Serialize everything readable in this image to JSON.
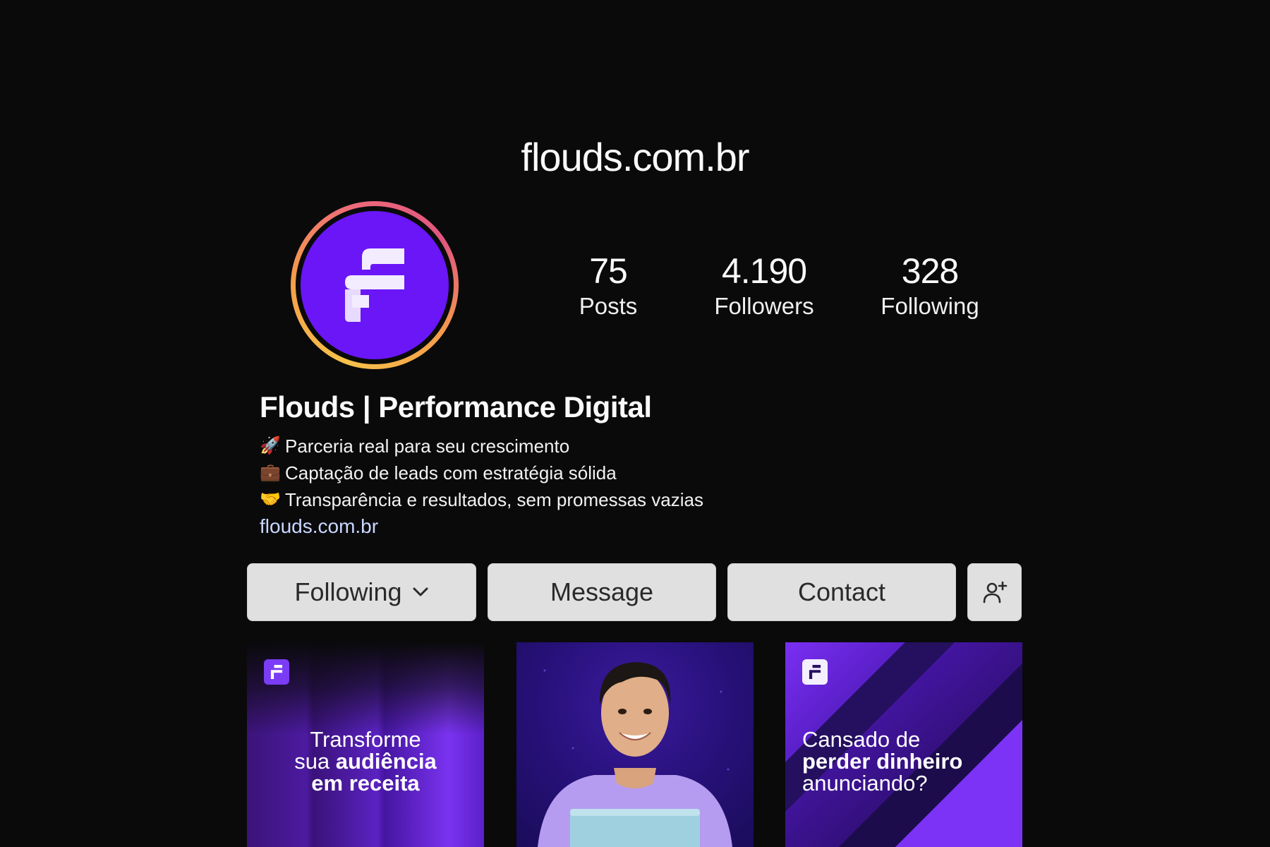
{
  "header": {
    "handle": "flouds.com.br"
  },
  "profile": {
    "avatar_icon": "flouds-logo-icon",
    "stats": [
      {
        "value": "75",
        "label": "Posts"
      },
      {
        "value": "4.190",
        "label": "Followers"
      },
      {
        "value": "328",
        "label": "Following"
      }
    ],
    "name": "Flouds | Performance Digital",
    "bio": [
      {
        "emoji": "🚀",
        "text": "Parceria real para seu crescimento"
      },
      {
        "emoji": "💼",
        "text": "Captação de leads com estratégia sólida"
      },
      {
        "emoji": "🤝",
        "text": "Transparência e resultados, sem promessas vazias"
      }
    ],
    "link": "flouds.com.br"
  },
  "actions": {
    "following": "Following",
    "message": "Message",
    "contact": "Contact"
  },
  "posts": [
    {
      "line1": "Transforme",
      "line2_pre": "sua ",
      "line2_bold": "audiência",
      "line3_bold": "em receita"
    },
    {
      "alt_icon": "smiling-man-photo"
    },
    {
      "line1": "Cansado de",
      "line2_bold": "perder dinheiro",
      "line3": "anunciando?"
    }
  ],
  "colors": {
    "accent": "#6a16f7",
    "background": "#0a0a0b",
    "button": "#e0e0e0",
    "link": "#c9d8ff"
  }
}
